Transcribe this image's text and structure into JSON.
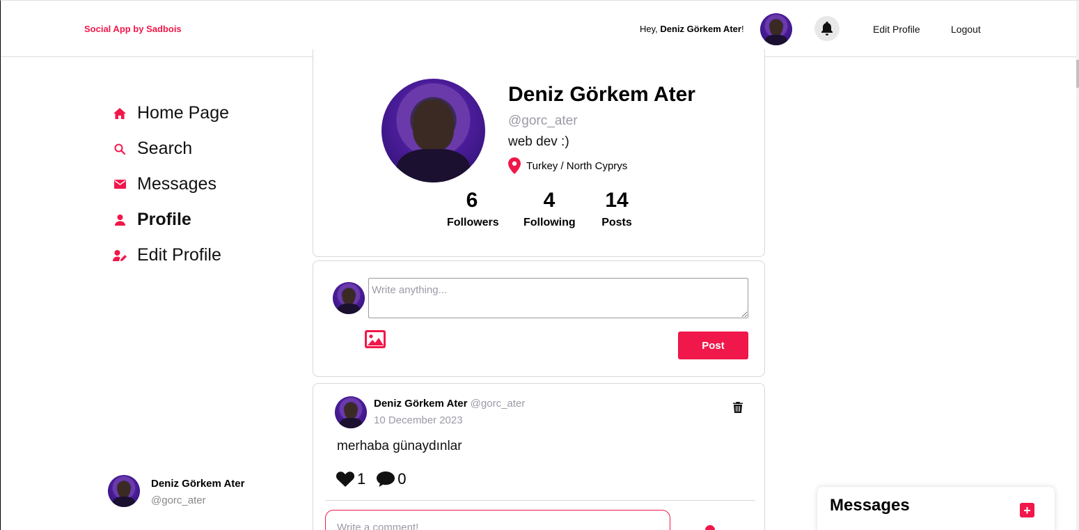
{
  "header": {
    "brand": "Social App by Sadbois",
    "greeting_prefix": "Hey, ",
    "greeting_name": "Deniz Görkem Ater",
    "greeting_suffix": "!",
    "edit_profile": "Edit Profile",
    "logout": "Logout"
  },
  "sidebar": {
    "items": [
      {
        "label": "Home Page",
        "icon": "home-icon"
      },
      {
        "label": "Search",
        "icon": "search-icon"
      },
      {
        "label": "Messages",
        "icon": "mail-icon"
      },
      {
        "label": "Profile",
        "icon": "user-icon",
        "active": true
      },
      {
        "label": "Edit Profile",
        "icon": "user-edit-icon"
      }
    ],
    "footer_user": {
      "name": "Deniz Görkem Ater",
      "handle": "@gorc_ater"
    }
  },
  "profile": {
    "name": "Deniz Görkem Ater",
    "handle": "@gorc_ater",
    "bio": "web dev :)",
    "location": "Turkey / North Cyprys",
    "stats": [
      {
        "value": "6",
        "label": "Followers"
      },
      {
        "value": "4",
        "label": "Following"
      },
      {
        "value": "14",
        "label": "Posts"
      }
    ]
  },
  "compose": {
    "placeholder": "Write anything...",
    "post_label": "Post"
  },
  "post": {
    "author": "Deniz Görkem Ater",
    "handle": "@gorc_ater",
    "date": "10 December 2023",
    "text": "merhaba günaydınlar",
    "likes": "1",
    "comments": "0",
    "comment_placeholder": "Write a comment!"
  },
  "messages_panel": {
    "title": "Messages",
    "add_label": "+"
  },
  "colors": {
    "accent": "#f0174a",
    "muted": "#9a9aa6"
  }
}
